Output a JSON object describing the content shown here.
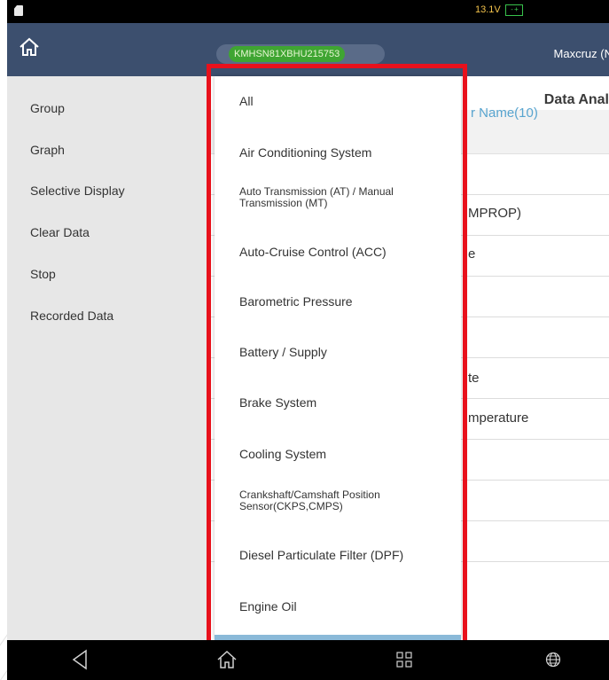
{
  "status_bar": {
    "voltage": "13.1V",
    "battery_glyph": "-+"
  },
  "top_bar": {
    "vin": "KMHSN81XBHU215753",
    "vehicle_name": "Maxcruz (N"
  },
  "left_menu": {
    "items": [
      {
        "label": "Group"
      },
      {
        "label": "Graph"
      },
      {
        "label": "Selective Display"
      },
      {
        "label": "Clear Data"
      },
      {
        "label": "Stop"
      },
      {
        "label": "Recorded Data"
      }
    ]
  },
  "right_panel": {
    "title": "Data Anal",
    "column_header": "r Name(10)",
    "rows": [
      {
        "text": ""
      },
      {
        "text": "MPROP)"
      },
      {
        "text": "e"
      },
      {
        "text": ""
      },
      {
        "text": ""
      },
      {
        "text": "te"
      },
      {
        "text": "mperature"
      },
      {
        "text": ""
      },
      {
        "text": ""
      },
      {
        "text": ""
      }
    ]
  },
  "dropdown": {
    "items": [
      {
        "label": "All"
      },
      {
        "label": "Air Conditioning System"
      },
      {
        "label": "Auto Transmission (AT) / Manual Transmission (MT)"
      },
      {
        "label": "Auto-Cruise Control (ACC)"
      },
      {
        "label": "Barometric Pressure"
      },
      {
        "label": "Battery / Supply"
      },
      {
        "label": "Brake System"
      },
      {
        "label": "Cooling System"
      },
      {
        "label": "Crankshaft/Camshaft Position Sensor(CKPS,CMPS)"
      },
      {
        "label": "Diesel Particulate Filter (DPF)"
      },
      {
        "label": "Engine Oil"
      }
    ]
  },
  "colors": {
    "highlight": "#e8111c",
    "vin_pill": "#3fa532",
    "topbar": "#3c4f6e",
    "header_text": "#58a4cf"
  },
  "icons": {
    "status_left": "sd-card-icon",
    "battery": "battery-icon",
    "home": "home-icon",
    "back": "back-icon",
    "apps": "grid-icon",
    "globe": "globe-icon"
  }
}
